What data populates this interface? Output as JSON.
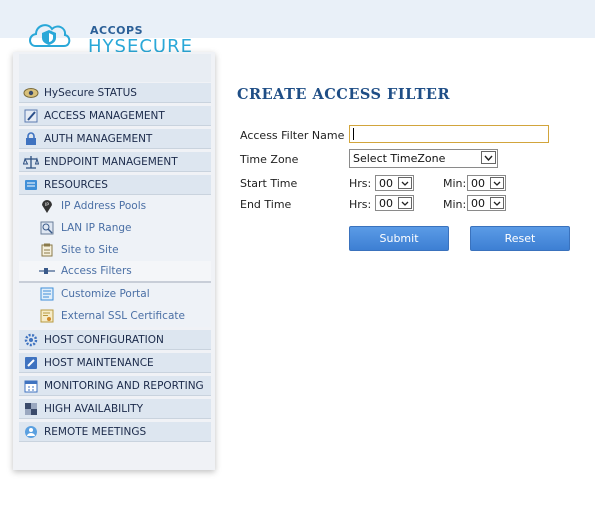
{
  "brand": {
    "company": "ACCOPS",
    "product": "HYSECURE"
  },
  "sidebar": {
    "items": [
      {
        "label": "HySecure STATUS",
        "icon": "eye-status-icon"
      },
      {
        "label": "ACCESS MANAGEMENT",
        "icon": "pen-icon"
      },
      {
        "label": "AUTH MANAGEMENT",
        "icon": "lock-icon"
      },
      {
        "label": "ENDPOINT MANAGEMENT",
        "icon": "scales-icon"
      },
      {
        "label": "RESOURCES",
        "icon": "cart-icon"
      },
      {
        "label": "HOST CONFIGURATION",
        "icon": "gears-icon"
      },
      {
        "label": "HOST MAINTENANCE",
        "icon": "wrench-icon"
      },
      {
        "label": "MONITORING AND REPORTING",
        "icon": "calendar-icon"
      },
      {
        "label": "HIGH AVAILABILITY",
        "icon": "cubes-icon"
      },
      {
        "label": "REMOTE MEETINGS",
        "icon": "meeting-icon"
      }
    ],
    "resources_sub": [
      {
        "label": "IP Address Pools",
        "icon": "ip-pin-icon"
      },
      {
        "label": "LAN IP Range",
        "icon": "lan-icon"
      },
      {
        "label": "Site to Site",
        "icon": "clipboard-icon"
      },
      {
        "label": "Access Filters",
        "icon": "filter-plug-icon"
      },
      {
        "label": "Customize Portal",
        "icon": "portal-icon"
      },
      {
        "label": "External SSL Certificate",
        "icon": "certificate-icon"
      }
    ]
  },
  "form": {
    "title": "CREATE ACCESS FILTER",
    "name_label": "Access Filter Name",
    "name_value": "",
    "timezone_label": "Time Zone",
    "timezone_value": "Select TimeZone",
    "start_label": "Start Time",
    "end_label": "End Time",
    "hrs_label": "Hrs:",
    "min_label": "Min:",
    "start_hrs": "00",
    "start_min": "00",
    "end_hrs": "00",
    "end_min": "00",
    "submit_label": "Submit",
    "reset_label": "Reset"
  },
  "colors": {
    "accent": "#1f4e86",
    "button": "#4a8ade",
    "logo_blue": "#2aa8d8",
    "input_focus": "#d2a53c"
  }
}
